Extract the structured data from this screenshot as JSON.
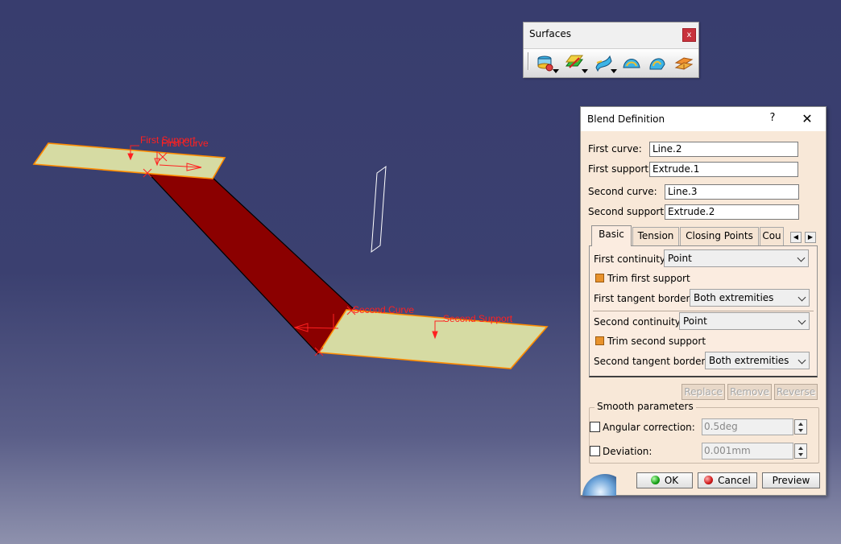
{
  "scene": {
    "labels": {
      "first_support": "First Support",
      "first_curve": "First Curve",
      "second_curve": "Second Curve",
      "second_support": "Second Support"
    },
    "colors": {
      "support_fill": "#d6dba3",
      "support_edge": "#ff8c00",
      "blend_fill": "#8b0000",
      "label": "#ff2020"
    }
  },
  "surfaces_toolbar": {
    "title": "Surfaces",
    "close_label": "x",
    "icons": [
      "extrude-surface-icon",
      "offset-surface-icon",
      "sweep-surface-icon",
      "fill-surface-icon",
      "multi-section-surface-icon",
      "blend-surface-icon"
    ]
  },
  "blend_dialog": {
    "title": "Blend Definition",
    "help_label": "?",
    "close_label": "✕",
    "first_curve": {
      "label": "First curve:",
      "value": "Line.2"
    },
    "first_support": {
      "label": "First support:",
      "value": "Extrude.1"
    },
    "second_curve": {
      "label": "Second curve:",
      "value": "Line.3"
    },
    "second_support": {
      "label": "Second support:",
      "value": "Extrude.2"
    },
    "tabs": [
      {
        "label": "Basic",
        "active": true
      },
      {
        "label": "Tension",
        "active": false
      },
      {
        "label": "Closing Points",
        "active": false
      },
      {
        "label": "Cou",
        "active": false
      }
    ],
    "basic": {
      "first_continuity": {
        "label": "First continuity:",
        "value": "Point"
      },
      "trim_first_support": {
        "label": "Trim first support",
        "checked": true
      },
      "first_tangent_borders": {
        "label": "First tangent borders:",
        "value": "Both extremities"
      },
      "second_continuity": {
        "label": "Second continuity:",
        "value": "Point"
      },
      "trim_second_support": {
        "label": "Trim second support",
        "checked": true
      },
      "second_tangent_borders": {
        "label": "Second tangent borders:",
        "value": "Both extremities"
      }
    },
    "buttons": {
      "replace": "Replace",
      "remove": "Remove",
      "reverse": "Reverse",
      "ok": "OK",
      "cancel": "Cancel",
      "preview": "Preview"
    },
    "smooth": {
      "title": "Smooth parameters",
      "angular_correction": {
        "label": "Angular correction:",
        "value": "0.5deg",
        "checked": false
      },
      "deviation": {
        "label": "Deviation:",
        "value": "0.001mm",
        "checked": false
      }
    }
  }
}
